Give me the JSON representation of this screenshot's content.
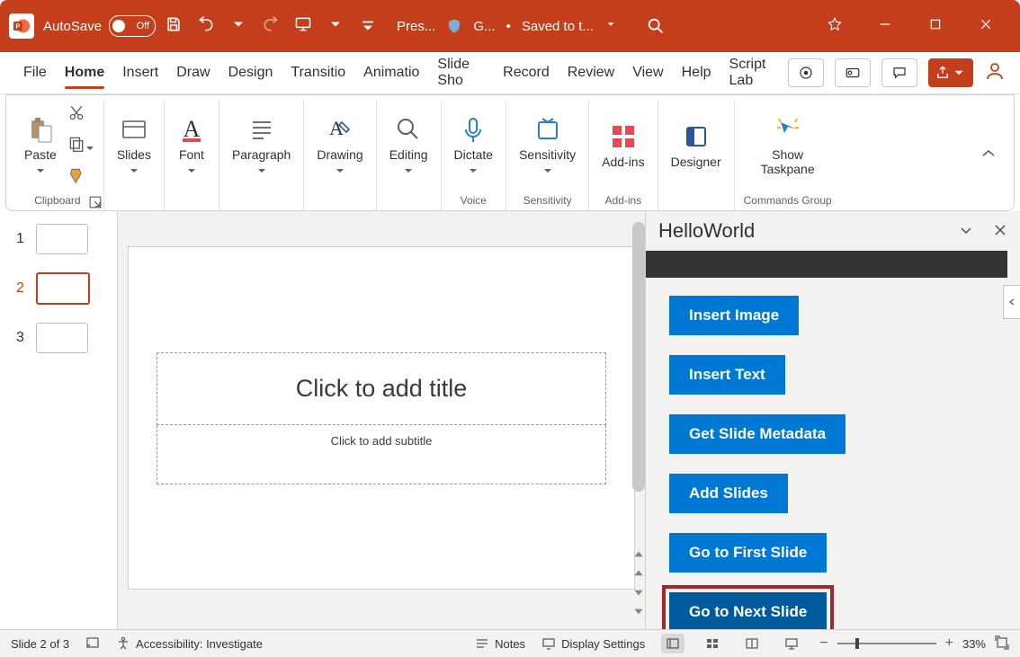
{
  "title": {
    "autosave": "AutoSave",
    "off": "Off",
    "docname": "Pres...",
    "sensitivity_label": "G...",
    "save_state": "Saved to t..."
  },
  "tabs": {
    "file": "File",
    "home": "Home",
    "insert": "Insert",
    "draw": "Draw",
    "design": "Design",
    "transitions": "Transitio",
    "animations": "Animatio",
    "slideshow": "Slide Sho",
    "record": "Record",
    "review": "Review",
    "view": "View",
    "help": "Help",
    "scriptlab": "Script Lab"
  },
  "ribbon": {
    "clipboard": "Clipboard",
    "paste": "Paste",
    "slides": "Slides",
    "font": "Font",
    "paragraph": "Paragraph",
    "drawing": "Drawing",
    "editing": "Editing",
    "dictate": "Dictate",
    "voice": "Voice",
    "sensitivity": "Sensitivity",
    "sensitivity_grp": "Sensitivity",
    "addins": "Add-ins",
    "addins_grp": "Add-ins",
    "designer": "Designer",
    "showtaskpane_l1": "Show",
    "showtaskpane_l2": "Taskpane",
    "commands_grp": "Commands Group"
  },
  "thumbs": [
    {
      "n": "1"
    },
    {
      "n": "2"
    },
    {
      "n": "3"
    }
  ],
  "slide": {
    "title_ph": "Click to add title",
    "sub_ph": "Click to add subtitle"
  },
  "pane": {
    "title": "HelloWorld",
    "buttons": {
      "insert_image": "Insert Image",
      "insert_text": "Insert Text",
      "get_meta": "Get Slide Metadata",
      "add_slides": "Add Slides",
      "first": "Go to First Slide",
      "next": "Go to Next Slide"
    }
  },
  "status": {
    "slide": "Slide 2 of 3",
    "acc": "Accessibility: Investigate",
    "notes": "Notes",
    "display": "Display Settings",
    "zoom": "33%"
  }
}
